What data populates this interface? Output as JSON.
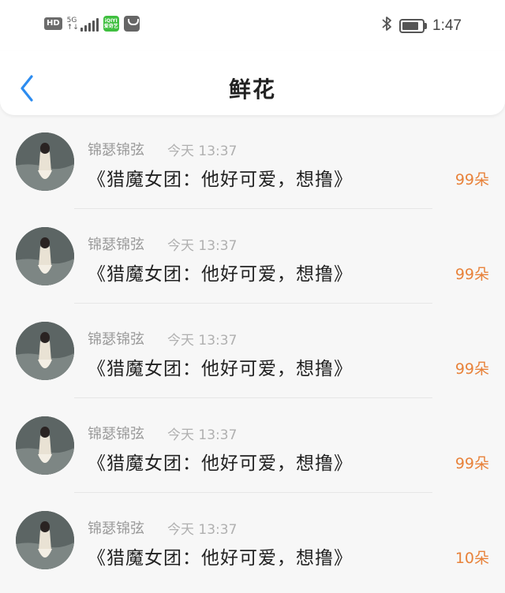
{
  "status_bar": {
    "hd": "HD",
    "network_top": "5G",
    "network_bottom": "↑↓",
    "app_badge_top": "iQIYI",
    "app_badge_bottom": "爱奇艺",
    "bluetooth_icon": "bluetooth-icon",
    "battery_icon": "battery-icon",
    "time": "1:47"
  },
  "header": {
    "title": "鲜花",
    "back_icon": "chevron-left-icon",
    "accent_color": "#2d8cf0"
  },
  "list": {
    "items": [
      {
        "author": "锦瑟锦弦",
        "time": "今天 13:37",
        "title": "《猎魔女团：他好可爱，想撸》",
        "flowers": "99朵"
      },
      {
        "author": "锦瑟锦弦",
        "time": "今天 13:37",
        "title": "《猎魔女团：他好可爱，想撸》",
        "flowers": "99朵"
      },
      {
        "author": "锦瑟锦弦",
        "time": "今天 13:37",
        "title": "《猎魔女团：他好可爱，想撸》",
        "flowers": "99朵"
      },
      {
        "author": "锦瑟锦弦",
        "time": "今天 13:37",
        "title": "《猎魔女团：他好可爱，想撸》",
        "flowers": "99朵"
      },
      {
        "author": "锦瑟锦弦",
        "time": "今天 13:37",
        "title": "《猎魔女团：他好可爱，想撸》",
        "flowers": "10朵"
      }
    ],
    "flower_color": "#e8823a"
  }
}
